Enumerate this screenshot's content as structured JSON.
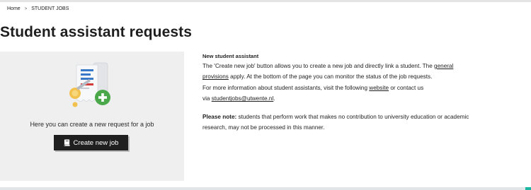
{
  "breadcrumb": {
    "home": "Home",
    "separator": ">",
    "current": "STUDENT JOBS"
  },
  "page": {
    "title": "Student assistant requests"
  },
  "card": {
    "caption": "Here you can create a new request for a job",
    "button_label": "Create new job",
    "icon": "book-icon",
    "illustration": "job-request-illustration"
  },
  "info": {
    "heading": "New student assistant",
    "p1_a": "The 'Create new job' button allows you to create a new job and directly link a student. The ",
    "link_provisions_1": "general",
    "link_provisions_2": "provisions",
    "p1_b": " apply. At the bottom of the page you can monitor the status of the job requests.",
    "p1_c": "For more information about student assistants, visit the following ",
    "link_website": "website",
    "p1_d": " or contact us",
    "p1_e": "via ",
    "link_email": "studentjobs@utwente.nl",
    "p1_f": ".",
    "note_label": "Please note:",
    "note_text_a": " students that perform work that makes no contribution to university education or academic",
    "note_text_b": "research, may not be processed in this manner."
  },
  "colors": {
    "accent": "#1ab8a4",
    "button_bg": "#1f1f1f",
    "card_bg": "#efefef",
    "plus_green": "#4aa84a",
    "pencil_yellow": "#f2c14e"
  }
}
